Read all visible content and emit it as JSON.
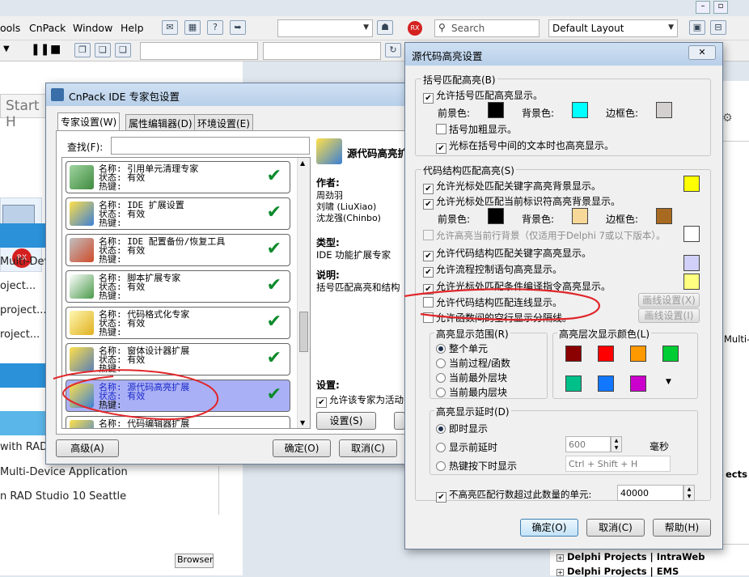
{
  "ide": {
    "menu": [
      "ools",
      "CnPack",
      "Window",
      "Help"
    ],
    "search_placeholder": "Search",
    "layout_combo": "Default Layout",
    "start_tab": "Start H",
    "left_items": [
      "Multi-Device",
      "oject...",
      "project...",
      "roject...",
      "with RAD S",
      "Multi-Device Application",
      "n RAD Studio 10 Seattle"
    ],
    "right_items": [
      "Multi-E",
      "ects"
    ],
    "browser_tab": "Browser",
    "bottom_rows": [
      "Delphi Projects | IntraWeb",
      "Delphi Projects | EMS"
    ]
  },
  "cnpack": {
    "title": "CnPack IDE 专家包设置",
    "tabs": [
      "专家设置(W)",
      "属性编辑器(D)",
      "环境设置(E)"
    ],
    "search_label": "查找(F):",
    "wizards": [
      {
        "name": "名称: 引用单元清理专家",
        "status": "状态: 有效",
        "hotkey": "热键:",
        "icon": "unit-cleaner-icon"
      },
      {
        "name": "名称: IDE 扩展设置",
        "status": "状态: 有效",
        "hotkey": "热键:",
        "icon": "ide-enhance-icon"
      },
      {
        "name": "名称: IDE 配置备份/恢复工具",
        "status": "状态: 有效",
        "hotkey": "热键:",
        "icon": "backup-tools-icon"
      },
      {
        "name": "名称: 脚本扩展专家",
        "status": "状态: 有效",
        "hotkey": "热键:",
        "icon": "script-icon"
      },
      {
        "name": "名称: 代码格式化专家",
        "status": "状态: 有效",
        "hotkey": "热键:",
        "icon": "code-format-icon"
      },
      {
        "name": "名称: 窗体设计器扩展",
        "status": "状态: 有效",
        "hotkey": "热键:",
        "icon": "form-designer-icon"
      },
      {
        "name": "名称: 源代码高亮扩展",
        "status": "状态: 有效",
        "hotkey": "热键:",
        "icon": "source-highlight-icon"
      },
      {
        "name": "名称: 代码编辑器扩展",
        "status": "",
        "hotkey": "",
        "icon": "editor-icon"
      }
    ],
    "detail_title": "源代码高亮扩",
    "author_label": "作者:",
    "authors": [
      "周劲羽",
      "刘啸 (LiuXiao)",
      "沈龙强(Chinbo)"
    ],
    "type_label": "类型:",
    "type_value": "IDE 功能扩展专家",
    "desc_label": "说明:",
    "desc_value": "括号匹配高亮和结构",
    "settings_label": "设置:",
    "allow_active": "允许该专家为活动",
    "settings_button": "设置(S)",
    "advanced_button": "高级(A)",
    "ok_button": "确定(O)",
    "cancel_button": "取消(C)"
  },
  "highlight": {
    "title": "源代码高亮设置",
    "group_bracket": "括号匹配高亮(B)",
    "allow_bracket": "允许括号匹配高亮显示。",
    "fg_label": "前景色:",
    "bg_label": "背景色:",
    "border_label": "边框色:",
    "bracket_bold": "括号加粗显示。",
    "bracket_cursor_in": "光标在括号中间的文本时也高亮显示。",
    "group_struct": "代码结构匹配高亮(S)",
    "struct_keyword_bg": "允许光标处匹配关键字高亮背景显示。",
    "struct_ident_bg": "允许光标处匹配当前标识符高亮背景显示。",
    "current_line_bg": "允许高亮当前行背景（仅适用于Delphi 7或以下版本）。",
    "struct_keyword": "允许代码结构匹配关键字高亮显示。",
    "flow_control": "允许流程控制语句高亮显示。",
    "cond_compile": "允许光标处匹配条件编译指令高亮显示。",
    "struct_line": "允许代码结构匹配连线显示。",
    "func_separator": "允许函数间的空行显示分隔线。",
    "line_settings_1": "画线设置(X)",
    "line_settings_2": "画线设置(I)",
    "range_group": "高亮显示范围(R)",
    "range_options": [
      "整个单元",
      "当前过程/函数",
      "当前最外层块",
      "当前最内层块"
    ],
    "level_group": "高亮层次显示颜色(L)",
    "delay_group": "高亮显示延时(D)",
    "delay_options": [
      "即时显示",
      "显示前延时",
      "热键按下时显示"
    ],
    "delay_value": "600",
    "delay_unit": "毫秒",
    "hotkey_value": "Ctrl + Shift + H",
    "no_highlight_label": "不高亮匹配行数超过此数量的单元:",
    "max_lines": "40000",
    "ok_button": "确定(O)",
    "cancel_button": "取消(C)",
    "help_button": "帮助(H)",
    "colors": {
      "bracket_fg": "#000000",
      "bracket_bg": "#00ffff",
      "bracket_border": "#d4d0d0",
      "keyword_bg": "#ffff00",
      "ident_fg": "#000000",
      "ident_bg": "#f8d898",
      "ident_border": "#a86a20",
      "current_line": "#ffffff",
      "flow": "#d0d0f8",
      "cond": "#ffff80",
      "levels": [
        "#8b0000",
        "#ff0000",
        "#ff9900",
        "#00cc33",
        "#00c08a",
        "#1177ff",
        "#cc00cc"
      ]
    }
  }
}
